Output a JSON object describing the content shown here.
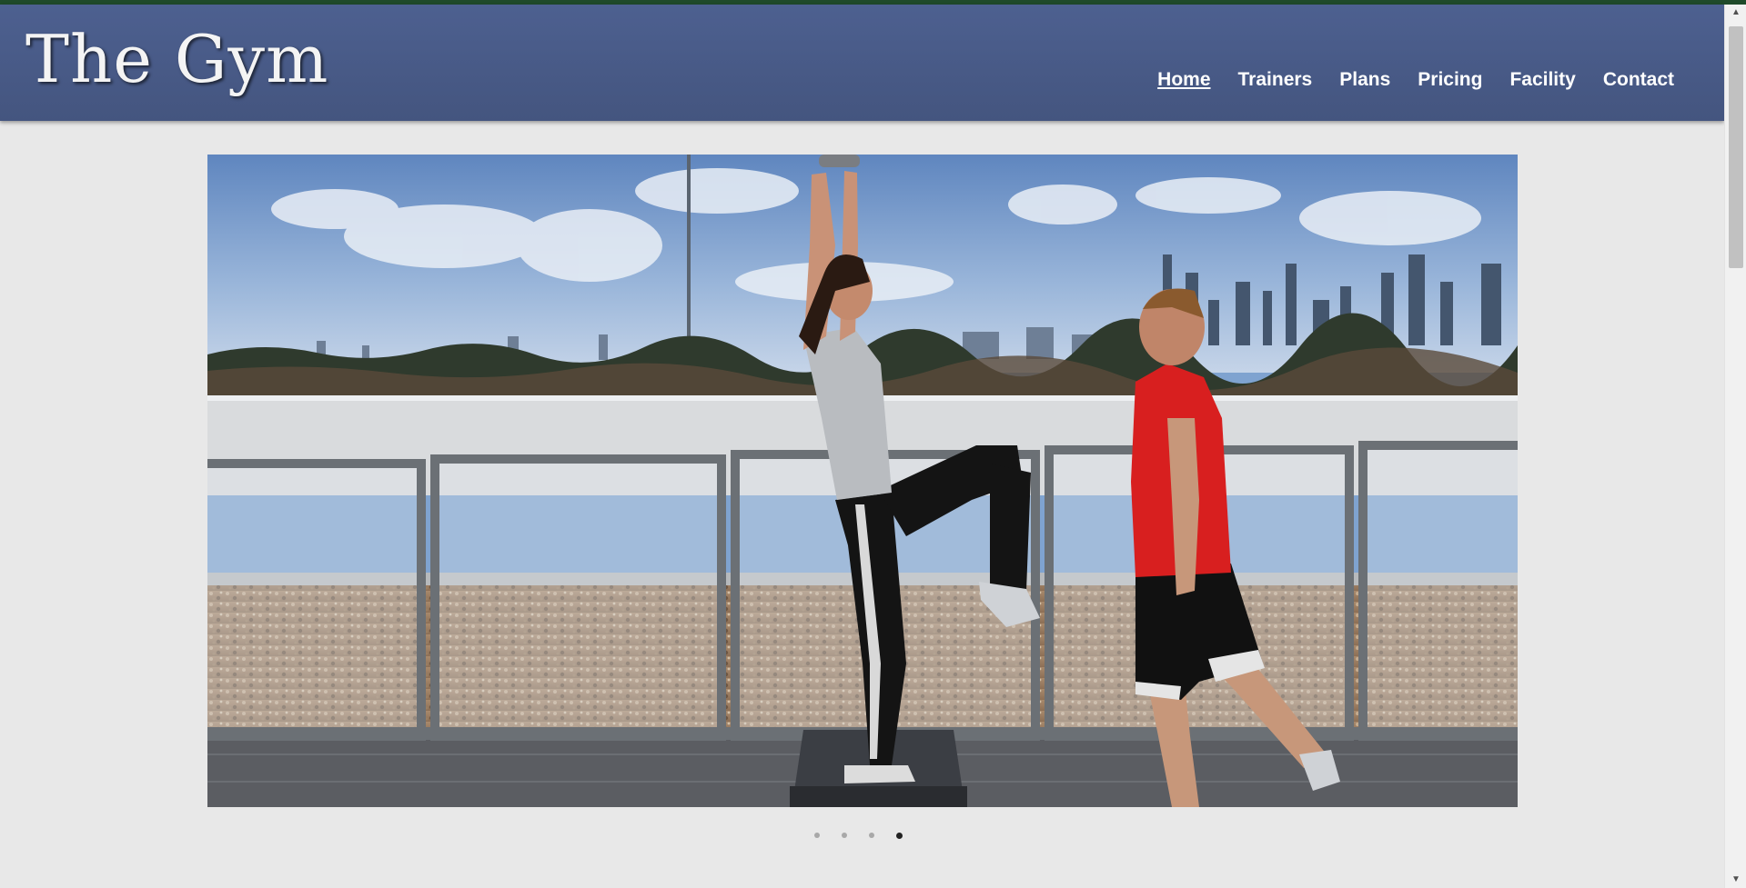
{
  "site": {
    "logo_text": "The Gym"
  },
  "nav": {
    "items": [
      {
        "label": "Home",
        "active": true
      },
      {
        "label": "Trainers",
        "active": false
      },
      {
        "label": "Plans",
        "active": false
      },
      {
        "label": "Pricing",
        "active": false
      },
      {
        "label": "Facility",
        "active": false
      },
      {
        "label": "Contact",
        "active": false
      }
    ]
  },
  "slider": {
    "total_slides": 4,
    "active_slide": 4,
    "image_description_icon": "hero-photo-rooftop-training"
  },
  "colors": {
    "header_bg": "#4a5c8a",
    "page_bg": "#e8e8e8",
    "accent_red": "#d81f1f"
  }
}
